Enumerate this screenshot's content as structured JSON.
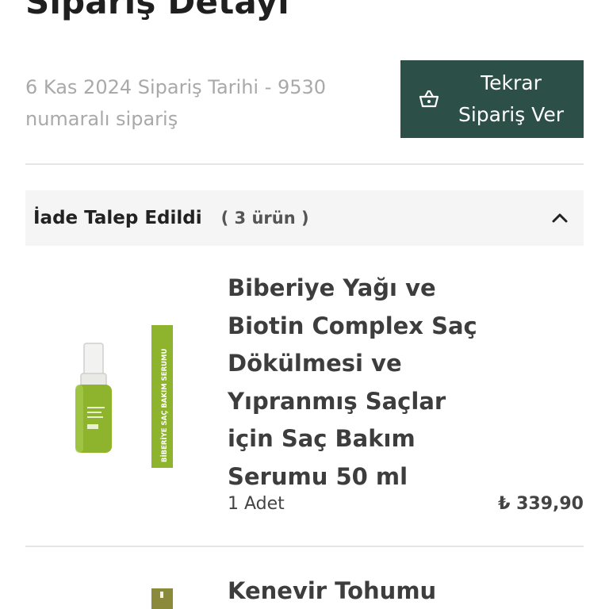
{
  "page": {
    "title": "Sipariş Detayı"
  },
  "order": {
    "meta_text": "6 Kas 2024 Sipariş Tarihi - 9530 numaralı sipariş",
    "reorder_label": "Tekrar Sipariş Ver",
    "reorder_icon": "basket-icon"
  },
  "group": {
    "status_label": "İade Talep Edildi",
    "count_label": "( 3 ürün )",
    "toggle_icon": "chevron-up-icon"
  },
  "items": [
    {
      "name": "Biberiye Yağı ve Biotin Complex Saç Dökülmesi ve Yıpranmış Saçlar için Saç Bakım Serumu 50 ml",
      "quantity": "1 Adet",
      "price": "₺ 339,90",
      "image_box_text": "BİBERİYE SAÇ BAKIM SERUMU"
    },
    {
      "name": "Kenevir Tohumu"
    }
  ],
  "colors": {
    "accent": "#2c4f48",
    "product_green": "#8db42c"
  }
}
